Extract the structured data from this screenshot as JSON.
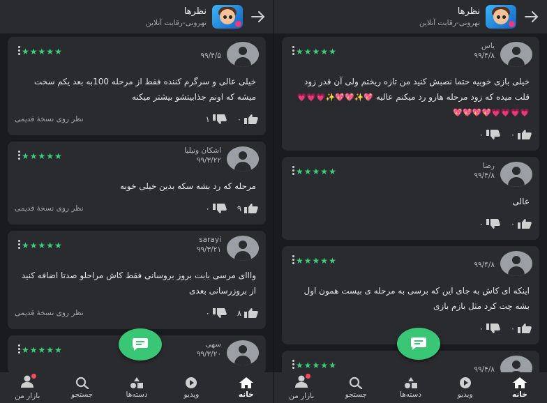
{
  "header": {
    "title": "نظرها",
    "subtitle": "تهرونی-رقابت آنلاین"
  },
  "bottom_nav": [
    {
      "label": "خانه",
      "icon": "home-icon",
      "active": true
    },
    {
      "label": "ویدیو",
      "icon": "play-icon",
      "active": false
    },
    {
      "label": "دسته‌ها",
      "icon": "categories-icon",
      "active": false
    },
    {
      "label": "جستجو",
      "icon": "search-icon",
      "active": false
    },
    {
      "label": "بازار من",
      "icon": "profile-icon",
      "active": false
    }
  ],
  "colors": {
    "accent": "#3ccf7a",
    "background": "#1a1b1e",
    "card": "#2a2b2e",
    "badge": "#ff4a5a"
  },
  "left_reviews": [
    {
      "user": "",
      "date": "۹۹/۴/۵",
      "rating": 5,
      "text": "خیلی عالی و سرگرم کننده فقط از مرحله 100به بعد یکم سخت میشه که اونم جذابیتشو بیشتر میکنه",
      "likes": "۰",
      "dislikes": "۱",
      "old_version": "نظر روی نسخهٔ قدیمی"
    },
    {
      "user": "اشکان ونیلیا",
      "date": "۹۹/۳/۲۲",
      "rating": 5,
      "text": "مرحله که رد بشه  سکه بدین خیلی خوبه",
      "likes": "۹",
      "dislikes": "۰",
      "old_version": "نظر روی نسخهٔ قدیمی"
    },
    {
      "user": "sarayi",
      "date": "۹۹/۳/۲۱",
      "rating": 5,
      "text": "وااای مرسی بابت بروز بروسانی فقط کاش مراحلو صدتا اضافه کنید از بروزرسانی بعدی",
      "likes": "۸",
      "dislikes": "۰",
      "old_version": "نظر روی نسخهٔ قدیمی"
    },
    {
      "user": "سهی",
      "date": "۹۹/۳/۲۰",
      "rating": 5,
      "text": "",
      "likes": "",
      "dislikes": "",
      "old_version": ""
    }
  ],
  "right_reviews": [
    {
      "user": "یاس",
      "date": "۹۹/۴/۸",
      "rating": 5,
      "text": "خیلی بازی خوبیه حتما نصبش کنید من تازه ریختم ولی آن قدر  زود قلب میده که زود مرحله هارو رد میکنم عالیه",
      "hearts": "💖✨💖💖✨💗💗💗💗💗💗💗💖💖💖💖",
      "likes": "۰",
      "dislikes": "۰",
      "old_version": ""
    },
    {
      "user": "رضا",
      "date": "۹۹/۴/۸",
      "rating": 5,
      "text": "عالی",
      "hearts": "",
      "likes": "۰",
      "dislikes": "۰",
      "old_version": ""
    },
    {
      "user": "",
      "date": "۹۹/۴/۸",
      "rating": 5,
      "text": "اینکه ای کاش به جای این که برسی به مرحله ی بیست همون اول بشه چت کرد مثل بازم بازی",
      "hearts": "",
      "likes": "۰",
      "dislikes": "۰",
      "old_version": ""
    },
    {
      "user": "",
      "date": "۹۹/۴/۸",
      "rating": 5,
      "text": "",
      "hearts": "",
      "likes": "",
      "dislikes": "",
      "old_version": ""
    }
  ]
}
